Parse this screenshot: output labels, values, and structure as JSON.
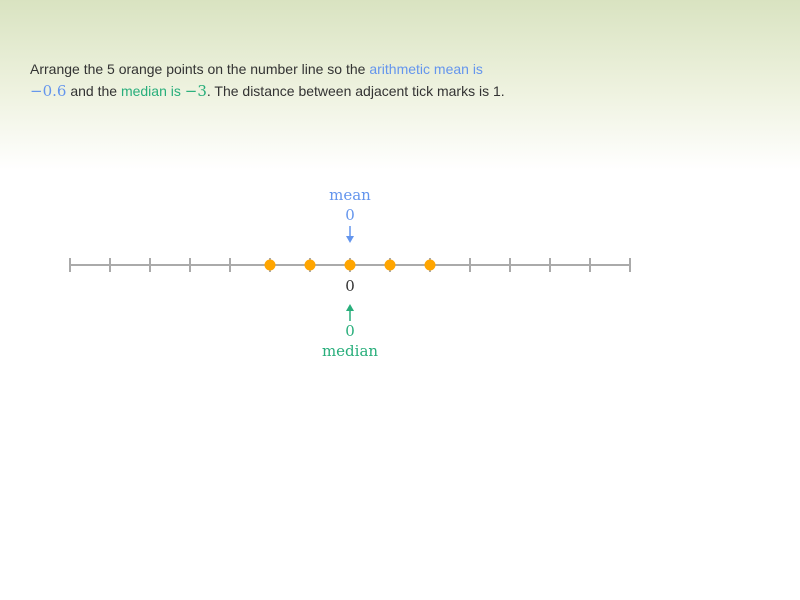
{
  "prompt": {
    "text_1": "Arrange the 5 orange points on the number line so the ",
    "mean_phrase": "arithmetic mean is",
    "mean_target": "−0.6",
    "text_2": " and the ",
    "median_phrase": "median is",
    "median_target": "−3",
    "text_3": ". The distance between adjacent tick marks is 1."
  },
  "number_line": {
    "min": -7,
    "max": 7,
    "tick_step": 1,
    "origin_label": "0",
    "points": [
      -2,
      -1,
      0,
      1,
      2
    ],
    "point_color": "#ffa500",
    "axis_color": "#aaaaaa"
  },
  "mean_indicator": {
    "label": "mean",
    "value": "0",
    "color": "#6495ed"
  },
  "median_indicator": {
    "label": "median",
    "value": "0",
    "color": "#28ae7b"
  }
}
